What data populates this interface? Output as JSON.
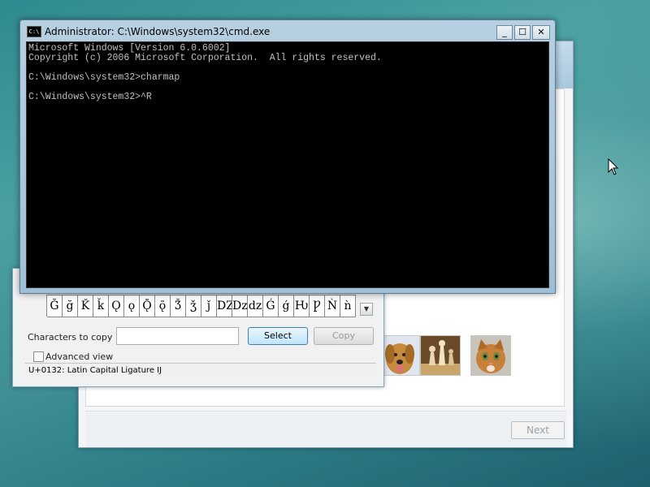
{
  "cmd": {
    "title": "Administrator: C:\\Windows\\system32\\cmd.exe",
    "icon_text": "C:\\",
    "controls": {
      "minimize": "_",
      "maximize": "☐",
      "close": "✕"
    },
    "lines": [
      "Microsoft Windows [Version 6.0.6002]",
      "Copyright (c) 2006 Microsoft Corporation.  All rights reserved.",
      "",
      "C:\\Windows\\system32>charmap",
      "",
      "C:\\Windows\\system32>^R"
    ]
  },
  "charmap": {
    "characters": [
      "Ğ",
      "ğ",
      "Ǩ",
      "ǩ",
      "Ǫ",
      "ǫ",
      "Ǭ",
      "ǭ",
      "Ǯ",
      "ǯ",
      "ǰ",
      "Ǳ",
      "ǲ",
      "ǳ",
      "Ǵ",
      "ǵ",
      "Ƕ",
      "Ƿ",
      "Ǹ",
      "ǹ"
    ],
    "scroll_glyph": "▼",
    "chars_to_copy_label": "Characters to copy",
    "chars_to_copy_value": "",
    "select_label": "Select",
    "copy_label": "Copy",
    "advanced_view_label": "Advanced view",
    "status": "U+0132: Latin Capital Ligature Ĳ"
  },
  "wizard": {
    "next_label": "Next"
  },
  "colors": {
    "console_bg": "#000000",
    "console_text": "#c0c0c0",
    "title_bar": "#b7d0e1"
  }
}
